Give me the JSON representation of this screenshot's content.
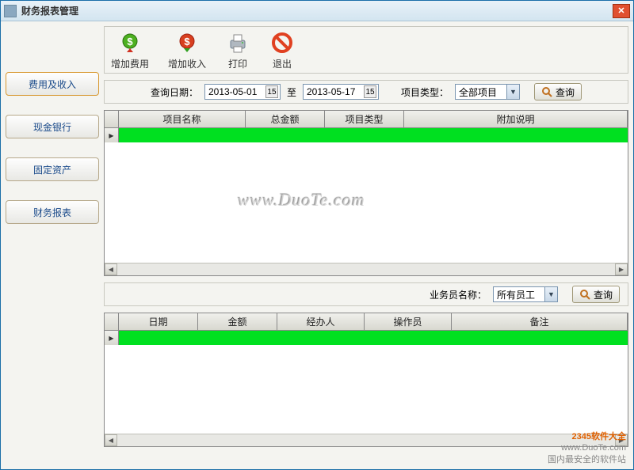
{
  "window": {
    "title": "财务报表管理"
  },
  "sidebar": {
    "items": [
      {
        "label": "费用及收入",
        "active": true
      },
      {
        "label": "现金银行",
        "active": false
      },
      {
        "label": "固定资产",
        "active": false
      },
      {
        "label": "财务报表",
        "active": false
      }
    ]
  },
  "toolbar": {
    "add_expense": "增加费用",
    "add_income": "增加收入",
    "print": "打印",
    "exit": "退出"
  },
  "filter1": {
    "date_label": "查询日期：",
    "date_from": "2013-05-01",
    "to_label": "至",
    "date_to": "2013-05-17",
    "type_label": "项目类型：",
    "type_value": "全部项目",
    "query_label": "查询"
  },
  "grid1": {
    "columns": [
      "项目名称",
      "总金额",
      "项目类型",
      "附加说明"
    ]
  },
  "filter2": {
    "staff_label": "业务员名称：",
    "staff_value": "所有员工",
    "query_label": "查询"
  },
  "grid2": {
    "columns": [
      "日期",
      "金额",
      "经办人",
      "操作员",
      "备注"
    ]
  },
  "watermark": "www.DuoTe.com",
  "footer": {
    "brand": "2345软件大全",
    "url": "www.DuoTe.com",
    "slogan": "国内最安全的软件站"
  }
}
